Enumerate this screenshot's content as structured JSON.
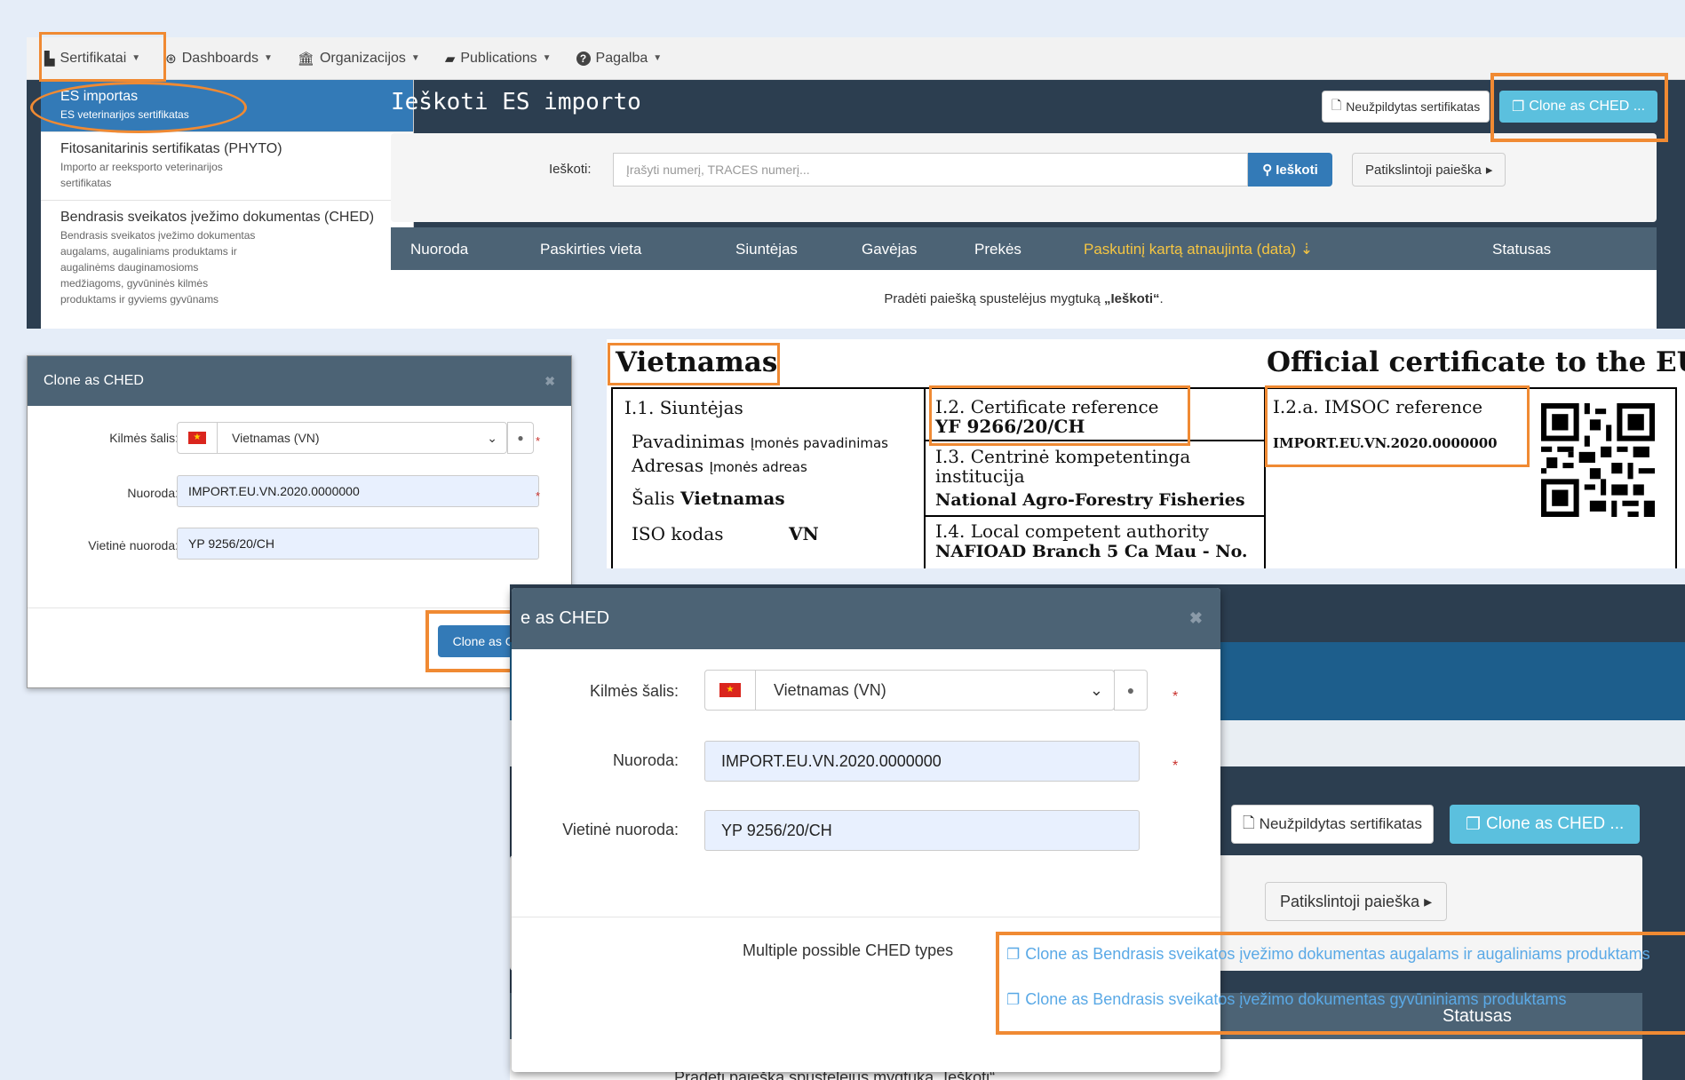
{
  "colors": {
    "highlight": "#f08a33",
    "nav_dark": "#2c3e50",
    "primary": "#337ab7",
    "info": "#5bc0de"
  },
  "navbar": [
    {
      "label": "Sertifikatai",
      "icon": "file-icon"
    },
    {
      "label": "Dashboards",
      "icon": "dashboard-icon"
    },
    {
      "label": "Organizacijos",
      "icon": "bank-icon"
    },
    {
      "label": "Publications",
      "icon": "book-icon"
    },
    {
      "label": "Pagalba",
      "icon": "question-icon"
    }
  ],
  "icons": {
    "file": "▙",
    "dashboard": "⊛",
    "bank": "🏛",
    "book": "▰",
    "question": "?",
    "caret": "▼",
    "search": "⚲",
    "copy": "❐",
    "doc": "🗋",
    "globe": "●",
    "close": "✖",
    "caret_right": "▸",
    "sort": "⇣",
    "select_arrow": "⌄"
  },
  "menu": [
    {
      "title": "ES importas",
      "subtitle": "ES veterinarijos sertifikatas"
    },
    {
      "title": "Fitosanitarinis sertifikatas (PHYTO)",
      "subtitle": "Importo ar reeksporto veterinarijos sertifikatas"
    },
    {
      "title": "Bendrasis sveikatos įvežimo dokumentas (CHED)",
      "subtitle": "Bendrasis sveikatos įvežimo dokumentas augalams, augaliniams produktams ir augalinėms dauginamosioms medžiagoms, gyvūninės kilmės produktams ir gyviems gyvūnams"
    }
  ],
  "page": {
    "title": "Ieškoti ES importo",
    "blank_cert_button": "Neužpildytas sertifikatas",
    "clone_button": "Clone as CHED ...",
    "search_label": "Ieškoti:",
    "search_placeholder": "Įrašyti numerį, TRACES numerį...",
    "search_button": "Ieškoti",
    "refine_button": "Patikslintoji paieška",
    "columns": [
      "Nuoroda",
      "Paskirties vieta",
      "Siuntėjas",
      "Gavėjas",
      "Prekės",
      "Paskutinį kartą atnaujinta (data)",
      "Statusas"
    ],
    "empty_prefix": "Pradėti paiešką spustelėjus mygtuką ",
    "empty_bold": "„Ieškoti“",
    "empty_suffix": "."
  },
  "modal": {
    "title": "Clone as CHED",
    "title_partial": "e as CHED",
    "country_label": "Kilmės šalis:",
    "country_value": "Vietnamas (VN)",
    "reference_label": "Nuoroda:",
    "reference_value": "IMPORT.EU.VN.2020.0000000",
    "local_reference_label": "Vietinė nuoroda:",
    "local_reference_value": "YP 9256/20/CH",
    "required_mark": "*",
    "submit_button": "Clone as CHED",
    "multiple_label": "Multiple possible CHED types",
    "links": [
      "Clone as Bendrasis sveikatos įvežimo dokumentas augalams ir augaliniams produktams",
      "Clone as Bendrasis sveikatos įvežimo dokumentas gyvūniniams produktams"
    ]
  },
  "certificate": {
    "country": "Vietnamas",
    "heading": "Official certificate to the EU",
    "consignor_label": "I.1. Siuntėjas",
    "name_label": "Pavadinimas",
    "name_value": "Įmonės pavadinimas",
    "address_label": "Adresas",
    "address_value": "Įmonės adreas",
    "country_label": "Šalis",
    "country_value": "Vietnamas",
    "iso_label": "ISO kodas",
    "iso_value": "VN",
    "ref_label": "I.2. Certificate reference",
    "ref_value": "YF 9266/20/CH",
    "central_label": "I.3. Centrinė kompetentinga institucija",
    "central_value": "National Agro-Forestry Fisheries",
    "local_label": "I.4. Local competent authority",
    "local_value": "NAFIOAD Branch 5 Ca Mau - No.",
    "imsoc_label": "I.2.a. IMSOC reference",
    "imsoc_value": "IMPORT.EU.VN.2020.0000000"
  },
  "background": {
    "blank_cert_button": "Neužpildytas sertifikatas",
    "clone_button": "Clone as CHED ...",
    "refine_button": "Patikslintoji paieška",
    "status_column": "Statusas",
    "footer_text": "Pradėti paiešką spustelėjus mygtuką „Ieškoti“"
  }
}
